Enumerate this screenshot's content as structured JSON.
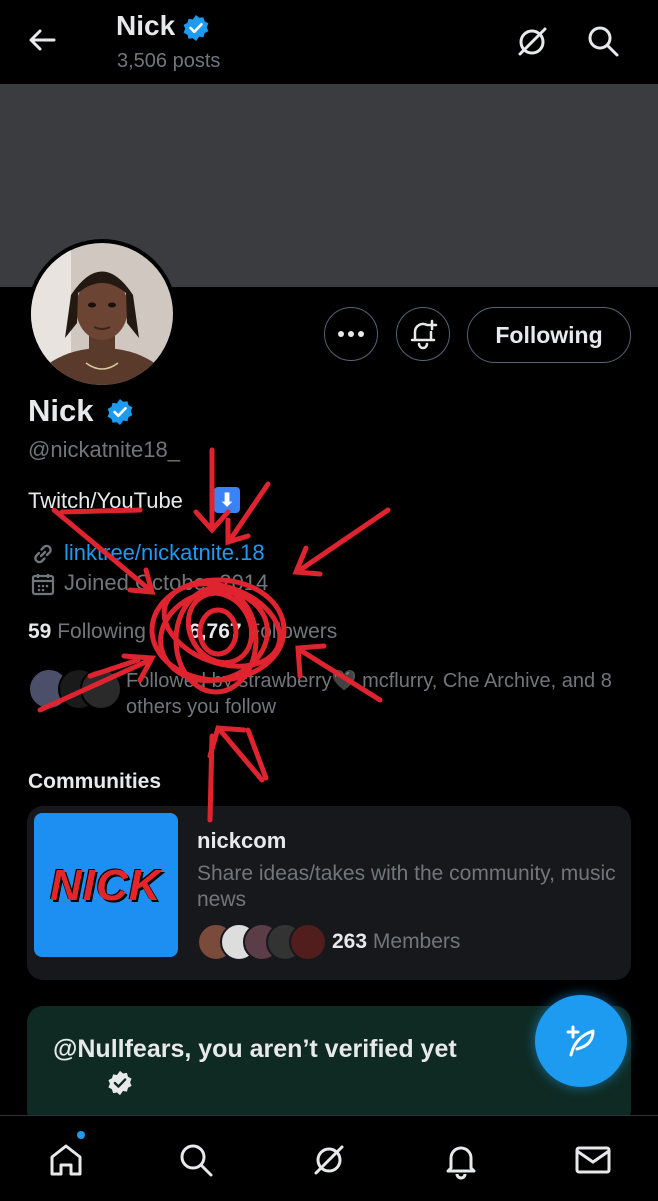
{
  "header": {
    "name": "Nick",
    "posts": "3,506 posts",
    "back_icon": "back-arrow-icon",
    "grok_icon": "grok-icon",
    "search_icon": "search-icon"
  },
  "profile": {
    "name": "Nick",
    "handle": "@nickatnite18_",
    "bio": "Twitch/YouTube",
    "bio_emoji": "⬇",
    "link": "linktree/nickatnite.18",
    "joined": "Joined October 2014",
    "following_count": "59",
    "following_label": "Following",
    "followers_count": "6,767",
    "followers_label": "Followers",
    "followed_by": "Followed by strawberry🖤 mcflurry, Che Archive, and 8 others you follow",
    "verified_color": "#1d9bf0"
  },
  "actions": {
    "more_icon": "more-icon",
    "notify_icon": "bell-plus-icon",
    "following_button": "Following"
  },
  "communities": {
    "title": "Communities",
    "items": [
      {
        "thumb_text": "NICK",
        "name": "nickcom",
        "description": "Share ideas/takes with the community, music news",
        "member_count": "263",
        "member_label": "Members"
      }
    ]
  },
  "verify_prompt": {
    "text": "@Nullfears, you aren’t verified yet"
  },
  "fab": {
    "icon": "compose-icon"
  },
  "bottom_nav": {
    "items": [
      "home-icon",
      "search-icon",
      "grok-icon",
      "notifications-icon",
      "messages-icon"
    ]
  },
  "colors": {
    "accent": "#1d9bf0",
    "annotation": "#e0242f"
  }
}
